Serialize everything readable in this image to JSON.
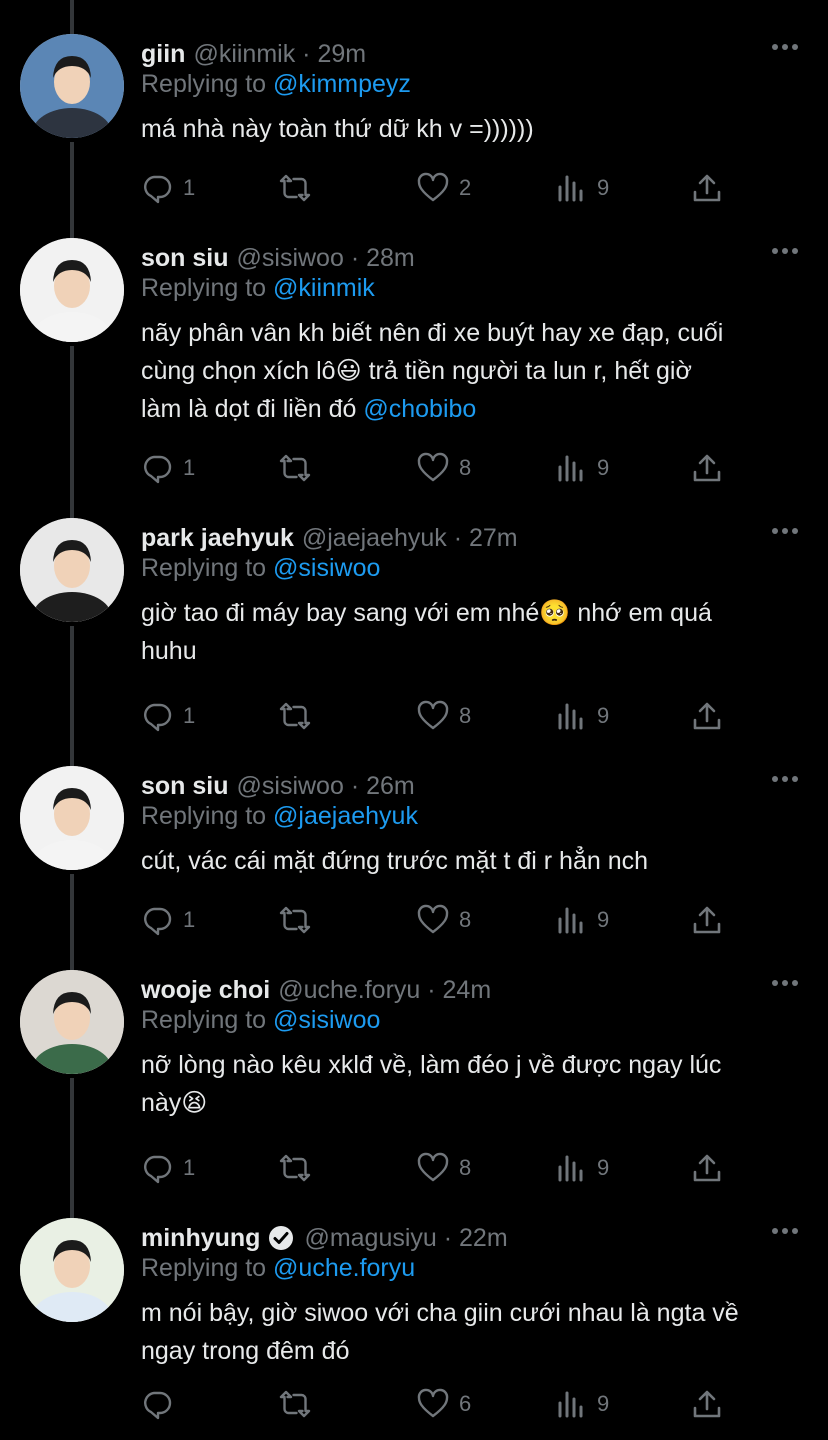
{
  "tweets": [
    {
      "name": "giin",
      "handle": "@kiinmik",
      "time": "29m",
      "verified": false,
      "replying_label": "Replying to",
      "replying_to": "@kimmpeyz",
      "text_lines": [
        "má nhà này toàn thứ dữ kh v =))))))"
      ],
      "replies": "1",
      "retweets": "",
      "likes": "2",
      "views": "9",
      "avatar": "person-avatar"
    },
    {
      "name": "son siu",
      "handle": "@sisiwoo",
      "time": "28m",
      "verified": false,
      "replying_label": "Replying to",
      "replying_to": "@kiinmik",
      "text_lines": [
        "nãy phân vân kh biết nên đi xe buýt hay xe đạp, cuối",
        "cùng chọn xích lô😃  trả tiền người ta lun r, hết giờ",
        "làm là dọt đi liền đó "
      ],
      "text_mention": "@chobibo",
      "replies": "1",
      "retweets": "",
      "likes": "8",
      "views": "9",
      "avatar": "person-avatar"
    },
    {
      "name": "park jaehyuk",
      "handle": "@jaejaehyuk",
      "time": "27m",
      "verified": false,
      "replying_label": "Replying to",
      "replying_to": "@sisiwoo",
      "text_lines": [
        "giờ tao đi máy bay sang với em nhé🥺  nhớ em quá",
        "huhu"
      ],
      "replies": "1",
      "retweets": "",
      "likes": "8",
      "views": "9",
      "avatar": "person-avatar"
    },
    {
      "name": "son siu",
      "handle": "@sisiwoo",
      "time": "26m",
      "verified": false,
      "replying_label": "Replying to",
      "replying_to": "@jaejaehyuk",
      "text_lines": [
        "cút, vác cái mặt đứng trước mặt t đi r hẳn nch"
      ],
      "replies": "1",
      "retweets": "",
      "likes": "8",
      "views": "9",
      "avatar": "person-avatar"
    },
    {
      "name": "wooje choi",
      "handle": "@uche.foryu",
      "time": "24m",
      "verified": false,
      "replying_label": "Replying to",
      "replying_to": "@sisiwoo",
      "text_lines": [
        "nỡ lòng nào kêu xklđ về, làm đéo j về được ngay lúc",
        "này😫"
      ],
      "replies": "1",
      "retweets": "",
      "likes": "8",
      "views": "9",
      "avatar": "person-avatar"
    },
    {
      "name": "minhyung",
      "handle": "@magusiyu",
      "time": "22m",
      "verified": true,
      "replying_label": "Replying to",
      "replying_to": "@uche.foryu",
      "text_lines": [
        "m nói bậy, giờ siwoo với cha giin cưới nhau là ngta về",
        "ngay trong đêm đó"
      ],
      "replies": "",
      "retweets": "",
      "likes": "6",
      "views": "9",
      "avatar": "person-avatar"
    }
  ],
  "colors": {
    "background": "#000000",
    "text": "#e7e9ea",
    "secondary": "#71767b",
    "accent": "#1d9bf0",
    "thread_line": "#333639"
  },
  "icons": [
    "reply-icon",
    "retweet-icon",
    "like-icon",
    "views-icon",
    "share-icon",
    "more-icon",
    "verified-icon"
  ]
}
